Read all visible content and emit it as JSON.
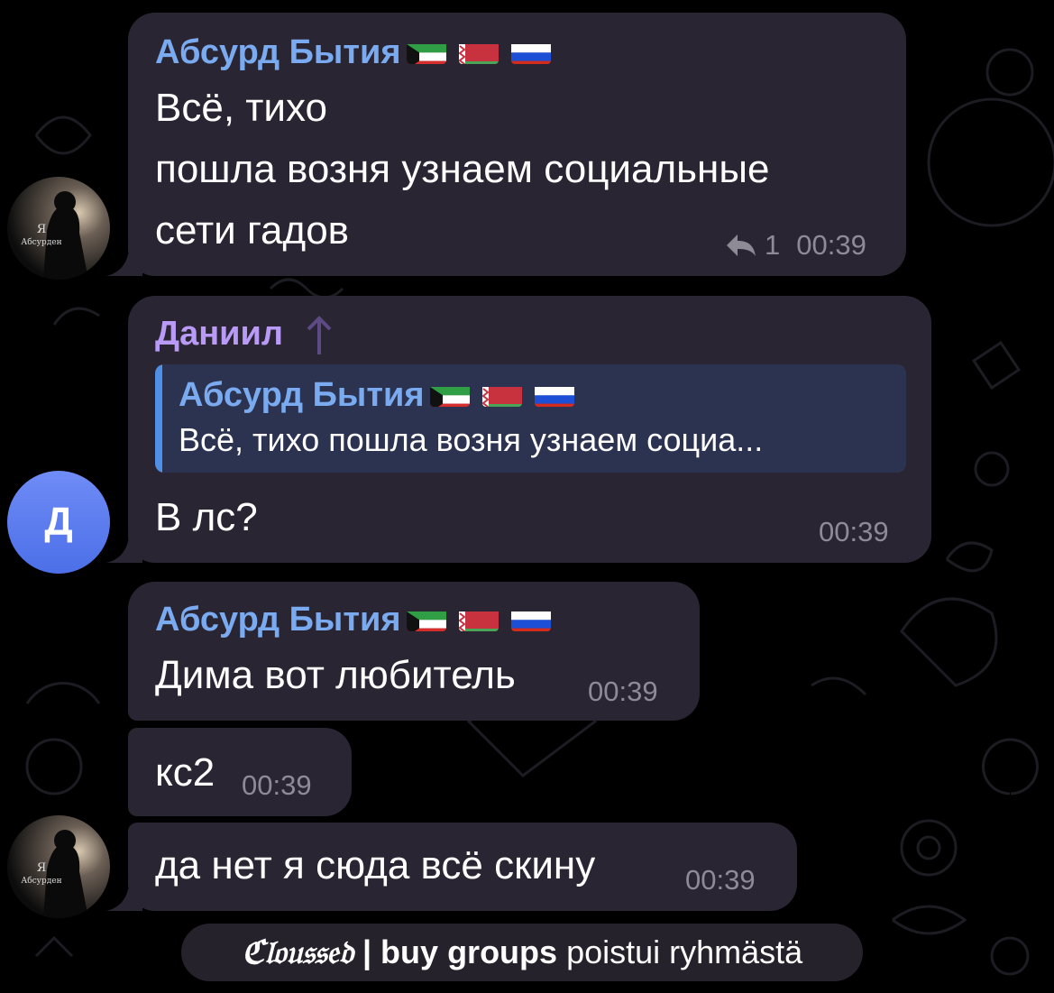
{
  "colors": {
    "background": "#000000",
    "bubble": "#2a2532",
    "sender_blue": "#7aaaf0",
    "sender_purple": "#b99af7",
    "quote_bg": "#2c3350",
    "quote_bar": "#4f8fe6",
    "time": "#8e8a96",
    "avatar_d": "#5b7cf2"
  },
  "sender_flags": [
    "kuwait-flag",
    "belarus-flag",
    "russia-flag"
  ],
  "messages": [
    {
      "sender": "Абсурд Бытия",
      "lines": [
        "Всё, тихо",
        "пошла возня узнаем социальные",
        "сети гадов"
      ],
      "reply_count": "1",
      "time": "00:39"
    },
    {
      "sender": "Даниил",
      "quote_sender": "Абсурд Бытия",
      "quote_text": "Всё, тихо пошла возня узнаем социа...",
      "text": "В лс?",
      "time": "00:39"
    },
    {
      "sender": "Абсурд Бытия",
      "text": "Дима вот любитель",
      "time": "00:39"
    },
    {
      "text": "кс2",
      "time": "00:39"
    },
    {
      "text": "да нет я сюда всё скину",
      "time": "00:39"
    }
  ],
  "avatars": {
    "absurd_caption_line1": "Я",
    "absurd_caption_line2": "Абсурден",
    "daniil_letter": "Д"
  },
  "service": {
    "name": "ℭ𝔩𝔬𝔲𝔰𝔰𝔢𝔡",
    "sep_name": " | buy groups",
    "action": " poistui ryhmästä"
  }
}
